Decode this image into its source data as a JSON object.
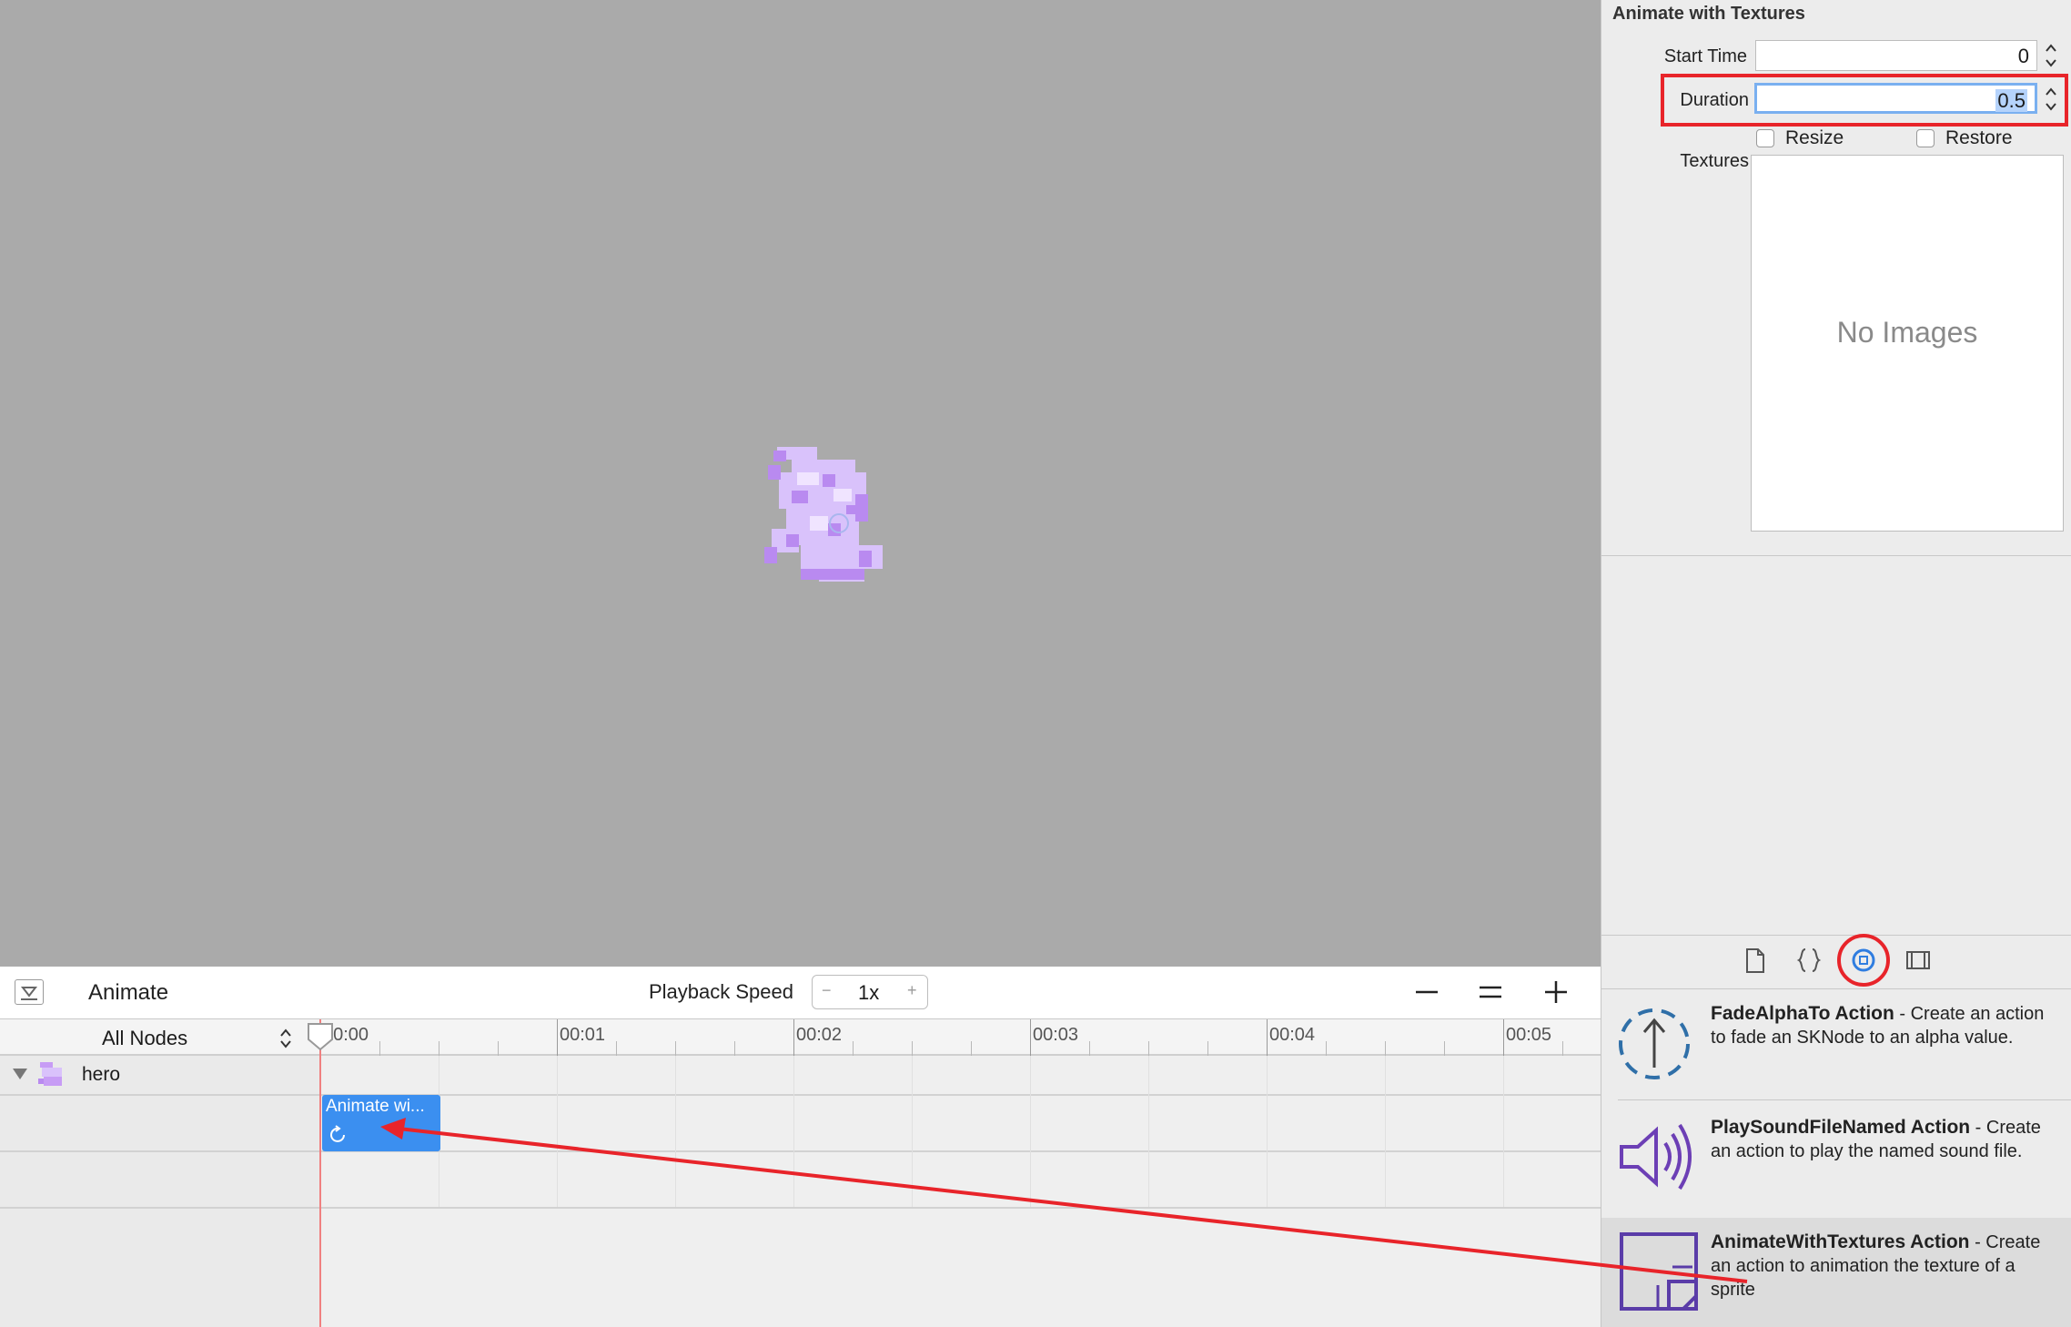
{
  "timeline": {
    "title": "Animate",
    "playback_speed_label": "Playback Speed",
    "speed_value": "1x",
    "speed_minus": "−",
    "speed_plus": "+",
    "nodes_filter": "All Nodes",
    "ruler_labels": [
      "00:00",
      "00:01",
      "00:02",
      "00:03",
      "00:04",
      "00:05"
    ],
    "node_name": "hero",
    "action_label": "Animate wi..."
  },
  "inspector": {
    "title": "Animate with Textures",
    "start_time_label": "Start Time",
    "start_time_value": "0",
    "duration_label": "Duration",
    "duration_value": "0.5",
    "resize_label": "Resize",
    "restore_label": "Restore",
    "textures_label": "Textures",
    "no_images": "No Images"
  },
  "library": {
    "tabs": [
      "file-icon",
      "braces-icon",
      "object-library-icon",
      "media-library-icon"
    ],
    "selected_tab": "object-library-icon",
    "items": [
      {
        "name": "FadeAlphaTo Action",
        "desc": "Create an action to fade an SKNode to an alpha value."
      },
      {
        "name": "PlaySoundFileNamed Action",
        "desc": "Create an action to play the named sound file."
      },
      {
        "name": "AnimateWithTextures Action",
        "desc": "Create an action to animation the texture of a sprite"
      }
    ]
  },
  "colors": {
    "accent_blue": "#3b8ff0",
    "highlight_red": "#e8242a",
    "sprite_purple": "#c79cf5",
    "scene_bg": "#aaaaaa"
  }
}
